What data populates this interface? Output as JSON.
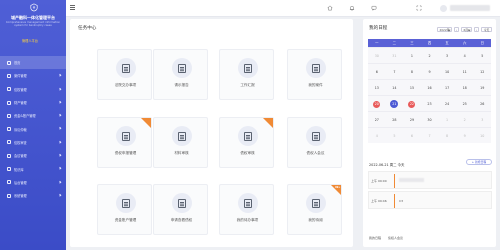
{
  "sidebar": {
    "title": "城产融科一体化管理平台",
    "subtitle": "Comprehensive management information system for bankruptcy cases",
    "tag": "管理人平台",
    "items": [
      {
        "label": "首页",
        "active": true
      },
      {
        "label": "案件管理"
      },
      {
        "label": "债权管理"
      },
      {
        "label": "财产管理"
      },
      {
        "label": "资金&账户管理"
      },
      {
        "label": "诉讼仲裁"
      },
      {
        "label": "债权审查"
      },
      {
        "label": "会议管理"
      },
      {
        "label": "知识库"
      },
      {
        "label": "后台管理"
      },
      {
        "label": "系统管理"
      }
    ]
  },
  "panel": {
    "title": "任务中心",
    "cards": [
      {
        "label": "法院交办事项",
        "ribbon": false
      },
      {
        "label": "请示报告",
        "ribbon": false
      },
      {
        "label": "工作汇报",
        "ribbon": false
      },
      {
        "label": "我的案件",
        "ribbon": false
      },
      {
        "label": "债权申报管理",
        "ribbon": true,
        "badge": ""
      },
      {
        "label": "材料审核",
        "ribbon": false
      },
      {
        "label": "债权审核",
        "ribbon": true,
        "badge": ""
      },
      {
        "label": "债权人会议",
        "ribbon": false
      },
      {
        "label": "资金账户管理",
        "ribbon": false
      },
      {
        "label": "申请查看债权",
        "ribbon": false
      },
      {
        "label": "我的待办事项",
        "ribbon": false
      },
      {
        "label": "我的待阅",
        "ribbon": true,
        "badge": "99+"
      }
    ]
  },
  "schedule": {
    "title": "我的日程",
    "year": "2022年",
    "month": "6月",
    "today_label": "今天",
    "weekdays": [
      "一",
      "二",
      "三",
      "四",
      "五",
      "六",
      "日"
    ],
    "weeks": [
      [
        {
          "d": "30",
          "m": true
        },
        {
          "d": "31",
          "m": true
        },
        {
          "d": "1"
        },
        {
          "d": "2"
        },
        {
          "d": "3"
        },
        {
          "d": "4"
        },
        {
          "d": "5"
        }
      ],
      [
        {
          "d": "6"
        },
        {
          "d": "7"
        },
        {
          "d": "8"
        },
        {
          "d": "9"
        },
        {
          "d": "10"
        },
        {
          "d": "11"
        },
        {
          "d": "12"
        }
      ],
      [
        {
          "d": "13"
        },
        {
          "d": "14"
        },
        {
          "d": "15"
        },
        {
          "d": "16"
        },
        {
          "d": "17"
        },
        {
          "d": "18"
        },
        {
          "d": "19"
        }
      ],
      [
        {
          "d": "20",
          "s": "red"
        },
        {
          "d": "21",
          "s": "blue"
        },
        {
          "d": "22",
          "s": "red"
        },
        {
          "d": "23"
        },
        {
          "d": "24"
        },
        {
          "d": "25"
        },
        {
          "d": "26"
        }
      ],
      [
        {
          "d": "27"
        },
        {
          "d": "28"
        },
        {
          "d": "29"
        },
        {
          "d": "30"
        },
        {
          "d": "1",
          "m": true
        },
        {
          "d": "2",
          "m": true
        },
        {
          "d": "3",
          "m": true
        }
      ],
      [
        {
          "d": "4",
          "m": true
        },
        {
          "d": "5",
          "m": true
        },
        {
          "d": "6",
          "m": true
        },
        {
          "d": "7",
          "m": true
        },
        {
          "d": "8",
          "m": true
        },
        {
          "d": "9",
          "m": true
        },
        {
          "d": "10",
          "m": true
        }
      ]
    ],
    "event_date": "2022-06-21 周二 今天",
    "add_label": "+ 新增日程",
    "events": [
      {
        "time": "上午 09:00",
        "text": ""
      },
      {
        "time": "上午 09:46",
        "text": "C3"
      }
    ],
    "footer": [
      "我的日程",
      "债权人会议"
    ]
  },
  "colors": {
    "sidebar": "#4656d1",
    "accent": "#5a61d6",
    "ribbon": "#f08a35",
    "highlight_red": "#e85a5a"
  }
}
